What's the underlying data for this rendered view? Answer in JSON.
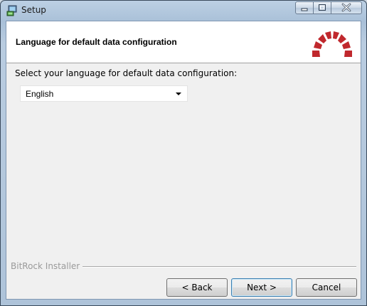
{
  "window": {
    "title": "Setup",
    "icons": {
      "app": "setup-app-icon",
      "minimize": "minimize-icon",
      "maximize": "maximize-icon",
      "close": "close-icon"
    }
  },
  "header": {
    "title": "Language for default data configuration",
    "logo": "redmine-logo-icon",
    "logo_color": "#c0282d"
  },
  "main": {
    "prompt": "Select your language for default data configuration:",
    "language_select": {
      "selected": "English"
    }
  },
  "footer": {
    "installer_label": "BitRock Installer",
    "buttons": {
      "back": "< Back",
      "next": "Next >",
      "cancel": "Cancel"
    }
  }
}
